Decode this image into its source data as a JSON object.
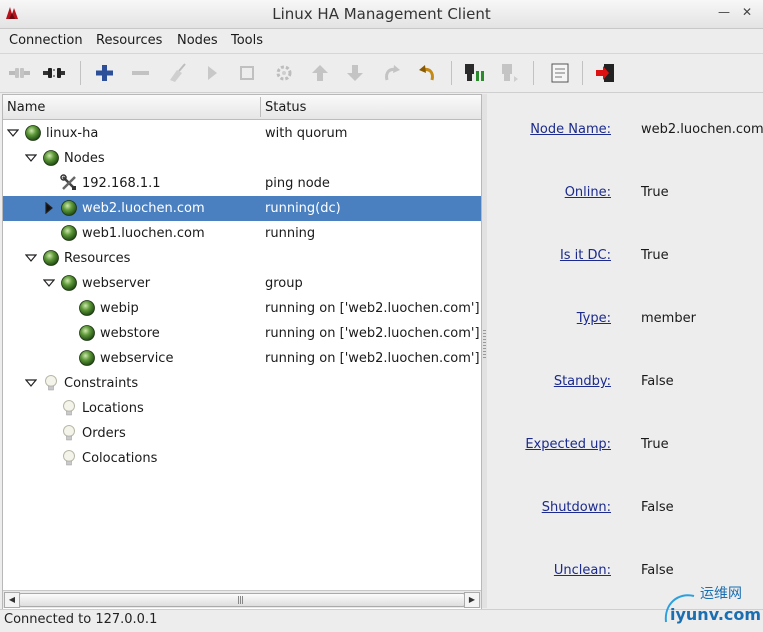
{
  "window": {
    "title": "Linux HA Management Client"
  },
  "menu": [
    "Connection",
    "Resources",
    "Nodes",
    "Tools"
  ],
  "toolbar": {
    "icons": [
      "connect-icon",
      "disconnect-icon",
      "add-icon",
      "remove-icon",
      "cleanup-icon",
      "start-icon",
      "stop-icon",
      "gear-icon",
      "move-up-icon",
      "move-down-icon",
      "redo-icon",
      "undo-icon",
      "standby-icon",
      "active-icon",
      "view-icon",
      "exit-icon"
    ]
  },
  "tree": {
    "columns": {
      "name": "Name",
      "status": "Status"
    },
    "rows": [
      {
        "name": "linux-ha",
        "status": "with quorum",
        "level": 0,
        "expanded": true,
        "icon": "green-orb-icon"
      },
      {
        "name": "Nodes",
        "status": "",
        "level": 1,
        "expanded": true,
        "icon": "green-orb-icon"
      },
      {
        "name": "192.168.1.1",
        "status": "ping node",
        "level": 2,
        "expanded": null,
        "icon": "tools-icon"
      },
      {
        "name": "web2.luochen.com",
        "status": "running(dc)",
        "level": 2,
        "expanded": false,
        "icon": "green-orb-icon",
        "selected": true
      },
      {
        "name": "web1.luochen.com",
        "status": "running",
        "level": 2,
        "expanded": null,
        "icon": "green-orb-icon"
      },
      {
        "name": "Resources",
        "status": "",
        "level": 1,
        "expanded": true,
        "icon": "green-orb-icon"
      },
      {
        "name": "webserver",
        "status": "group",
        "level": 2,
        "expanded": true,
        "icon": "green-orb-icon"
      },
      {
        "name": "webip",
        "status": "running on ['web2.luochen.com']",
        "level": 3,
        "expanded": null,
        "icon": "green-orb-icon"
      },
      {
        "name": "webstore",
        "status": "running on ['web2.luochen.com']",
        "level": 3,
        "expanded": null,
        "icon": "green-orb-icon"
      },
      {
        "name": "webservice",
        "status": "running on ['web2.luochen.com']",
        "level": 3,
        "expanded": null,
        "icon": "green-orb-icon"
      },
      {
        "name": "Constraints",
        "status": "",
        "level": 1,
        "expanded": true,
        "icon": "bulb-icon"
      },
      {
        "name": "Locations",
        "status": "",
        "level": 2,
        "expanded": null,
        "icon": "bulb-icon"
      },
      {
        "name": "Orders",
        "status": "",
        "level": 2,
        "expanded": null,
        "icon": "bulb-icon"
      },
      {
        "name": "Colocations",
        "status": "",
        "level": 2,
        "expanded": null,
        "icon": "bulb-icon"
      }
    ]
  },
  "details": [
    {
      "label": "Node Name:",
      "value": "web2.luochen.com"
    },
    {
      "label": "Online:",
      "value": "True"
    },
    {
      "label": "Is it DC:",
      "value": "True"
    },
    {
      "label": "Type:",
      "value": "member"
    },
    {
      "label": "Standby:",
      "value": "False"
    },
    {
      "label": "Expected up:",
      "value": "True"
    },
    {
      "label": "Shutdown:",
      "value": "False"
    },
    {
      "label": "Unclean:",
      "value": "False"
    }
  ],
  "status_bar": "Connected to 127.0.0.1",
  "watermark": {
    "text": "运维网",
    "url": "iyunv.com"
  }
}
